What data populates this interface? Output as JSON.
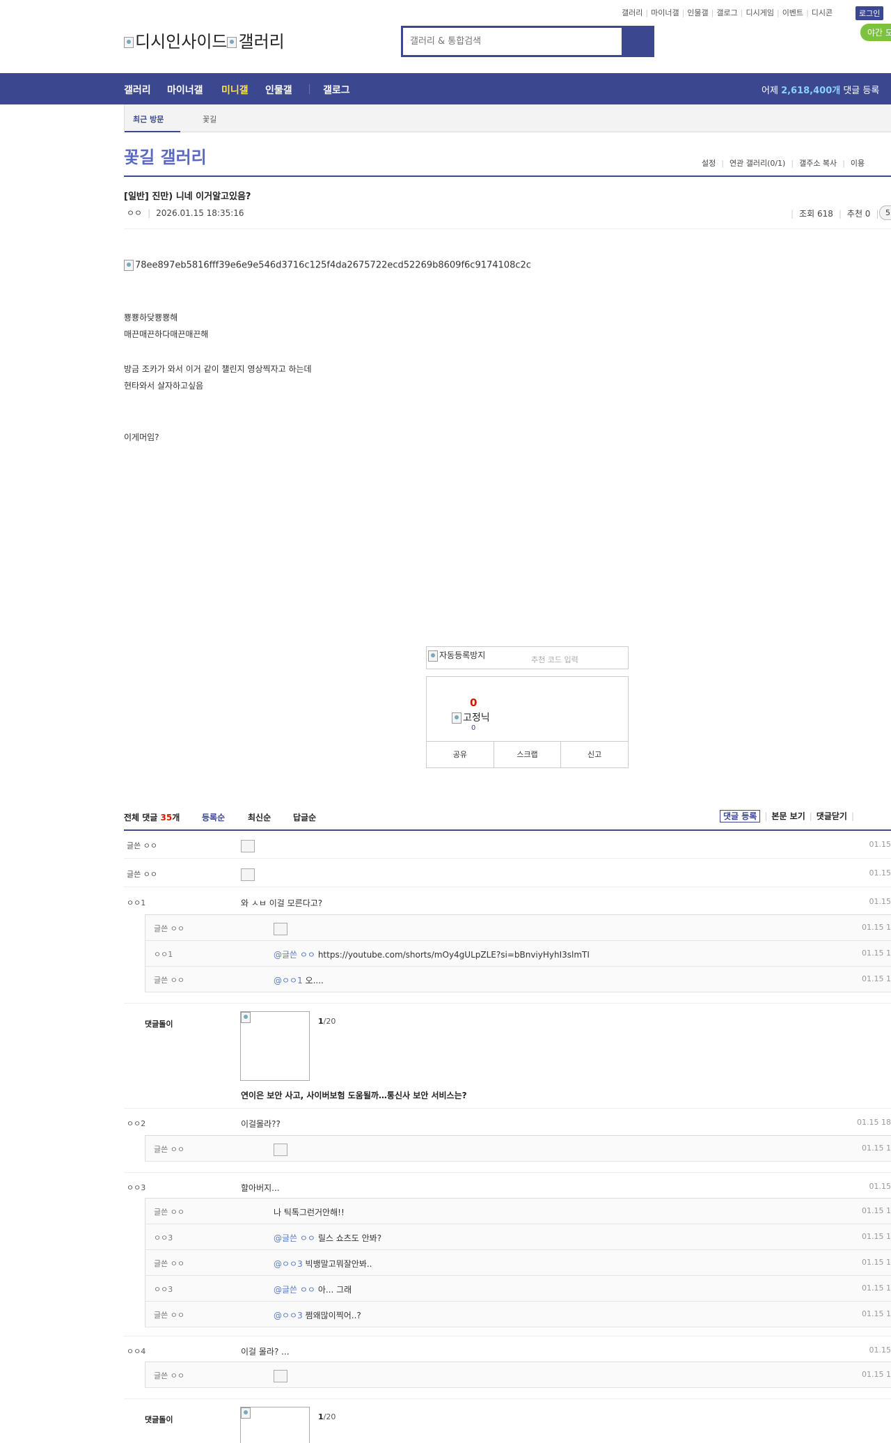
{
  "util_nav": {
    "items": [
      "갤러리",
      "마이너갤",
      "인물갤",
      "갤로그",
      "디시게임",
      "이벤트",
      "디시콘"
    ],
    "login": "로그인",
    "night_mode": "야간 모"
  },
  "header": {
    "logo_alt_1": "디시인사이드",
    "logo_alt_2": "갤러리",
    "search_placeholder": "갤러리 & 통합검색"
  },
  "gnb": {
    "items": [
      "갤러리",
      "마이너갤",
      "미니갤",
      "인물갤",
      "갤로그"
    ],
    "active_index": 2,
    "stat_prefix": "어제 ",
    "stat_value": "2,618,400개",
    "stat_suffix": " 댓글 등록"
  },
  "visit_bar": {
    "label": "최근 방문",
    "gallery": "꽃길"
  },
  "gallery": {
    "title": "꽃길 갤러리",
    "options": [
      "설정",
      "연관 갤러리(0/1)",
      "갤주소 복사",
      "이용"
    ]
  },
  "post": {
    "title": "[일반] 진만) 니네 이거알고있음?",
    "author": "ㅇㅇ",
    "date": "2026.01.15 18:35:16",
    "views_label": "조회 618",
    "recommend_label": "추천 0",
    "reply_count_badge": "5",
    "image_alt": "78ee897eb5816fff39e6e9e546d3716c125f4da2675722ecd52269b8609f6c9174108c2c",
    "lines": [
      "뿅뿅하닺뿅뿅해",
      "매끈매끈하다매끈매끈해",
      "방금 조카가 와서 이거 같이 챌린지 영상찍자고 하는데",
      "현타와서 살자하고싶음",
      "이게머임?"
    ]
  },
  "recommend": {
    "captcha_alt": "자동등록방지",
    "captcha_placeholder": "추천 코드 입력",
    "up_count": "0",
    "fix_label": "고정닉",
    "fix_count": "0",
    "buttons": [
      "공유",
      "스크랩",
      "신고"
    ]
  },
  "comments": {
    "total_prefix": "전체 댓글 ",
    "total_count": "35",
    "total_suffix": "개",
    "sort_tabs": [
      "등록순",
      "최신순",
      "답글순"
    ],
    "right_actions": [
      "댓글 등록",
      "본문 보기",
      "댓글닫기"
    ],
    "rows": [
      {
        "nick": "글쓴 ㅇㅇ",
        "text": "",
        "emoji": true,
        "date": "01.15"
      },
      {
        "nick": "글쓴 ㅇㅇ",
        "text": "",
        "emoji": true,
        "date": "01.15"
      },
      {
        "nick": "ㅇㅇ1",
        "text": "와 ㅅㅂ 이걸 모른다고?",
        "date": "01.15"
      },
      {
        "nick": "ㅇㅇ2",
        "text": "이걸몰라??",
        "date": "01.15 18"
      },
      {
        "nick": "ㅇㅇ3",
        "text": "할아버지...",
        "date": "01.15"
      },
      {
        "nick": "ㅇㅇ4",
        "text": "이걸 몰라? ...",
        "date": "01.15"
      }
    ],
    "replies": [
      {
        "nick": "글쓴 ㅇㅇ",
        "at": "",
        "text": "",
        "emoji": true,
        "date": "01.15 1"
      },
      {
        "nick": "ㅇㅇ1",
        "at": "@글쓴 ㅇㅇ",
        "text": "https://youtube.com/shorts/mOy4gULpZLE?si=bBnviyHyhI3slmTI",
        "date": "01.15 1"
      },
      {
        "nick": "글쓴 ㅇㅇ",
        "at": "@ㅇㅇ1",
        "text": "오....",
        "date": "01.15 1"
      },
      {
        "nick": "글쓴 ㅇㅇ",
        "at": "",
        "text": "",
        "emoji": true,
        "date": "01.15 1"
      },
      {
        "nick": "글쓴 ㅇㅇ",
        "at": "",
        "text": "나 틱톡그런거안해!!",
        "date": "01.15 1"
      },
      {
        "nick": "ㅇㅇ3",
        "at": "@글쓴 ㅇㅇ",
        "text": "릴스 쇼츠도 안봐?",
        "date": "01.15 1"
      },
      {
        "nick": "글쓴 ㅇㅇ",
        "at": "@ㅇㅇ3",
        "text": "빅뱅말고뭐잘안봐..",
        "date": "01.15 1"
      },
      {
        "nick": "ㅇㅇ3",
        "at": "@글쓴 ㅇㅇ",
        "text": "아... 그래",
        "date": "01.15 1"
      },
      {
        "nick": "글쓴 ㅇㅇ",
        "at": "@ㅇㅇ3",
        "text": "쩜왜많이찍어..?",
        "date": "01.15 1"
      },
      {
        "nick": "글쓴 ㅇㅇ",
        "at": "",
        "text": "",
        "emoji": true,
        "date": "01.15 1"
      }
    ],
    "ads": [
      {
        "label": "댓글돌이",
        "count_bold": "1",
        "count_rest": "/20",
        "headline": "연이은 보안 사고, 사이버보험 도움될까…통신사 보안 서비스는?"
      },
      {
        "label": "댓글돌이",
        "count_bold": "1",
        "count_rest": "/20",
        "headline": ""
      }
    ]
  },
  "colors": {
    "brand": "#3b4890",
    "accent_title": "#5a68c0",
    "night_button": "#7cc240",
    "count_red": "#d31900"
  }
}
